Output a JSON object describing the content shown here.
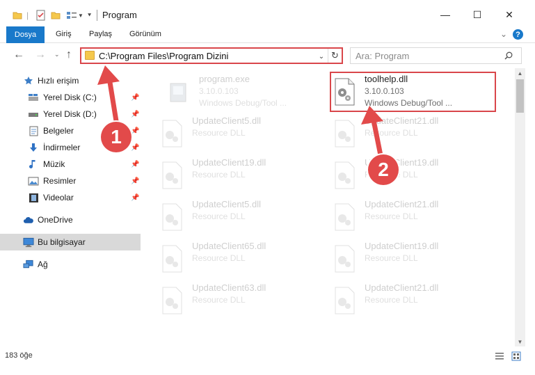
{
  "window": {
    "title": "Program",
    "minimize_glyph": "—",
    "maximize_glyph": "☐",
    "close_glyph": "✕"
  },
  "ribbon": {
    "tabs": [
      "Dosya",
      "Giriş",
      "Paylaş",
      "Görünüm"
    ],
    "help_glyph": "?",
    "accent": "#1979ca"
  },
  "navigation": {
    "address": "C:\\Program Files\\Program Dizini",
    "search_placeholder": "Ara: Program"
  },
  "sidebar": {
    "items": [
      {
        "label": "Hızlı erişim",
        "icon": "star-icon",
        "pinned": false
      },
      {
        "label": "Yerel Disk (C:)",
        "icon": "drive-icon",
        "pinned": true
      },
      {
        "label": "Yerel Disk (D:)",
        "icon": "drive-icon",
        "pinned": true
      },
      {
        "label": "Belgeler",
        "icon": "documents-icon",
        "pinned": true
      },
      {
        "label": "İndirmeler",
        "icon": "download-icon",
        "pinned": true
      },
      {
        "label": "Müzik",
        "icon": "music-icon",
        "pinned": true
      },
      {
        "label": "Resimler",
        "icon": "pictures-icon",
        "pinned": true
      },
      {
        "label": "Videolar",
        "icon": "video-icon",
        "pinned": true
      },
      {
        "label": "OneDrive",
        "icon": "cloud-icon",
        "pinned": false
      },
      {
        "label": "Bu bilgisayar",
        "icon": "computer-icon",
        "pinned": false,
        "selected": true
      },
      {
        "label": "Ağ",
        "icon": "network-icon",
        "pinned": false
      }
    ]
  },
  "files": {
    "left": [
      {
        "name": "program.exe",
        "line1": "3.10.0.103",
        "line2": "Windows Debug/Tool ...",
        "kind": "exe"
      },
      {
        "name": "UpdateClient5.dll",
        "line1": "Resource DLL",
        "kind": "dll"
      },
      {
        "name": "UpdateClient19.dll",
        "line1": "Resource DLL",
        "kind": "dll"
      },
      {
        "name": "UpdateClient5.dll",
        "line1": "Resource DLL",
        "kind": "dll"
      },
      {
        "name": "UpdateClient65.dll",
        "line1": "Resource DLL",
        "kind": "dll"
      },
      {
        "name": "UpdateClient63.dll",
        "line1": "Resource DLL",
        "kind": "dll"
      }
    ],
    "right": [
      {
        "name": "toolhelp.dll",
        "line1": "3.10.0.103",
        "line2": "Windows Debug/Tool ...",
        "kind": "dll",
        "highlighted": true
      },
      {
        "name": "UpdateClient21.dll",
        "line1": "Resource DLL",
        "kind": "dll"
      },
      {
        "name": "UpdateClient19.dll",
        "line1": "Resource DLL",
        "kind": "dll"
      },
      {
        "name": "UpdateClient21.dll",
        "line1": "Resource DLL",
        "kind": "dll"
      },
      {
        "name": "UpdateClient19.dll",
        "line1": "Resource DLL",
        "kind": "dll"
      },
      {
        "name": "UpdateClient21.dll",
        "line1": "Resource DLL",
        "kind": "dll"
      }
    ]
  },
  "status": {
    "item_count": "183 öğe"
  },
  "annotations": {
    "marker1": "1",
    "marker2": "2",
    "color": "#d9464a"
  }
}
